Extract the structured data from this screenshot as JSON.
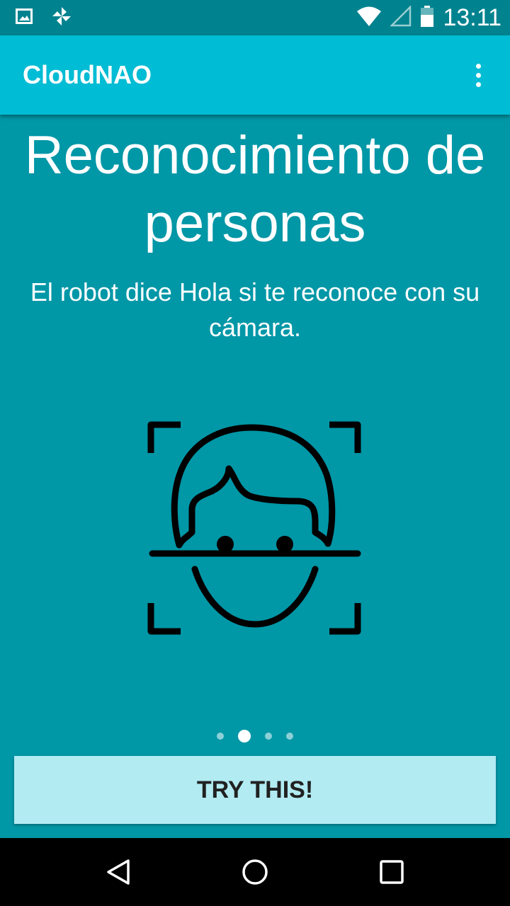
{
  "status_bar": {
    "time": "13:11",
    "icons": [
      "image-notification-icon",
      "pinwheel-notification-icon",
      "wifi-icon",
      "cell-signal-icon",
      "battery-icon"
    ]
  },
  "app_bar": {
    "title": "CloudNAO",
    "overflow_icon": "more-vert-icon"
  },
  "content": {
    "headline": "Reconocimiento de personas",
    "subtitle": "El robot dice Hola si te reconoce con su cámara.",
    "illustration": "face-recognition-icon"
  },
  "pager": {
    "total_pages": 4,
    "current_page": 2
  },
  "action": {
    "button_label": "TRY THIS!"
  },
  "navigation": {
    "icons": [
      "back-icon",
      "home-icon",
      "recents-icon"
    ]
  },
  "colors": {
    "status_bar": "#00838f",
    "app_bar": "#00bcd4",
    "background": "#0097a7",
    "button": "#b2ebf2",
    "nav_bar": "#000000"
  }
}
